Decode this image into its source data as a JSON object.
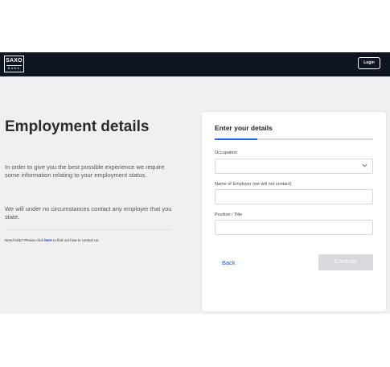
{
  "header": {
    "logo_line1": "SAXO",
    "logo_line2": "BANK",
    "login_label": "Login"
  },
  "page": {
    "title": "Employment details",
    "intro": "In order to give you the best possible experience we require some information relating to your employment status.",
    "assurance": "We will under no circumstances contact any employer that you state.",
    "help_prefix": "Need help? Please click",
    "help_link": "here",
    "help_suffix": "to find out how to contact us."
  },
  "form": {
    "title": "Enter your details",
    "progress_fraction": 0.27,
    "occupation_label": "Occupation",
    "occupation_value": "",
    "employer_label": "Name of Employer (we will not contact)",
    "employer_value": "",
    "position_label": "Position / Title",
    "position_value": "",
    "back_label": "Back",
    "continue_label": "Continue"
  },
  "colors": {
    "accent": "#1a6ef0",
    "header_bg": "#0e1521",
    "page_bg": "#f0f0f2",
    "continue_disabled": "#d8d9dd"
  }
}
